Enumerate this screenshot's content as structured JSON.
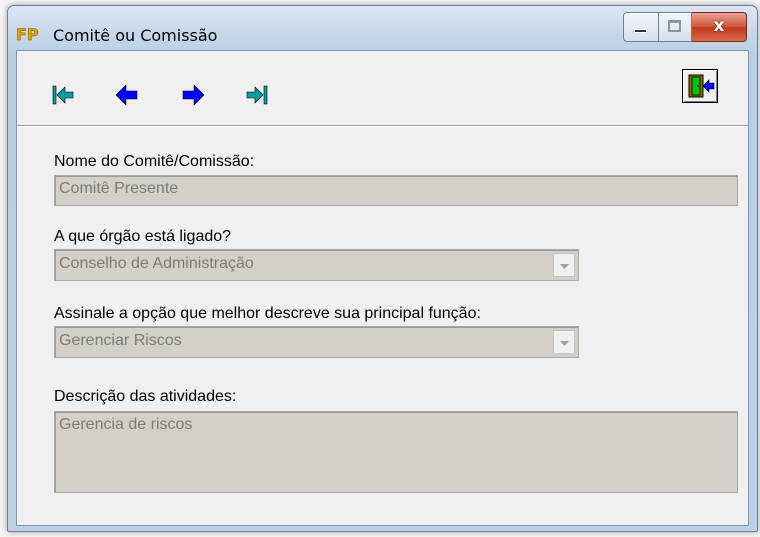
{
  "window": {
    "title": "Comitê ou Comissão",
    "app_icon": "fp-app-icon",
    "controls": {
      "minimize": "minimize-icon",
      "maximize": "maximize-icon",
      "close_label": "x"
    }
  },
  "toolbar": {
    "buttons": [
      {
        "name": "first-record",
        "icon": "arrow-first-icon",
        "color": "#00a0a0"
      },
      {
        "name": "previous-record",
        "icon": "arrow-left-icon",
        "color": "#0000ff"
      },
      {
        "name": "next-record",
        "icon": "arrow-right-icon",
        "color": "#0000ff"
      },
      {
        "name": "last-record",
        "icon": "arrow-last-icon",
        "color": "#00a0a0"
      }
    ],
    "exit_icon": "exit-door-icon"
  },
  "form": {
    "name_label": "Nome do Comitê/Comissão:",
    "name_value": "Comitê Presente",
    "organ_label": "A que órgão está ligado?",
    "organ_value": "Conselho de Administração",
    "function_label": "Assinale a opção que melhor descreve sua principal função:",
    "function_value": "Gerenciar Riscos",
    "description_label": "Descrição das atividades:",
    "description_value": "Gerencia de riscos"
  },
  "colors": {
    "disabled_field": "#d4d0c8",
    "disabled_text": "#7a7a7a"
  }
}
